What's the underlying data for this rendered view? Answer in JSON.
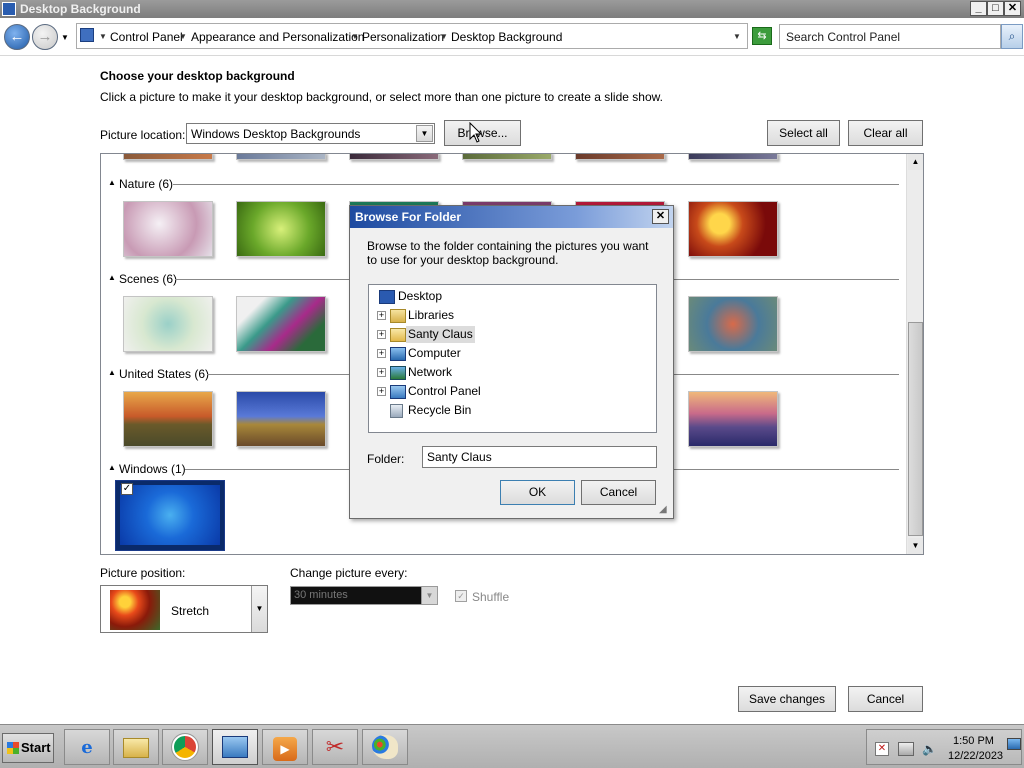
{
  "window": {
    "title": "Desktop Background",
    "min_label": "_",
    "max_label": "□",
    "close_label": "✕"
  },
  "address": {
    "back_glyph": "←",
    "forward_glyph": "→",
    "crumbs": [
      "Control Panel",
      "Appearance and Personalization",
      "Personalization",
      "Desktop Background"
    ],
    "search_placeholder": "Search Control Panel",
    "search_glyph": "⌕",
    "refresh_glyph": "⇆"
  },
  "main": {
    "heading": "Choose your desktop background",
    "description": "Click a picture to make it your desktop background, or select more than one picture to create a slide show.",
    "picture_location_label": "Picture location:",
    "picture_location_value": "Windows Desktop Backgrounds",
    "browse_label": "Browse...",
    "select_all_label": "Select all",
    "clear_all_label": "Clear all",
    "groups": [
      {
        "label": "Nature (6)"
      },
      {
        "label": "Scenes (6)"
      },
      {
        "label": "United States (6)"
      },
      {
        "label": "Windows (1)"
      }
    ],
    "picture_position_label": "Picture position:",
    "picture_position_value": "Stretch",
    "change_every_label": "Change picture every:",
    "change_every_value": "30 minutes",
    "shuffle_label": "Shuffle",
    "save_label": "Save changes",
    "cancel_label": "Cancel"
  },
  "dialog": {
    "title": "Browse For Folder",
    "close_glyph": "✕",
    "instructions": "Browse to the folder containing the pictures you want to use for your desktop background.",
    "tree": [
      {
        "label": "Desktop",
        "expandable": false
      },
      {
        "label": "Libraries",
        "expandable": true
      },
      {
        "label": "Santy Claus",
        "expandable": true,
        "selected": true
      },
      {
        "label": "Computer",
        "expandable": true
      },
      {
        "label": "Network",
        "expandable": true
      },
      {
        "label": "Control Panel",
        "expandable": true
      },
      {
        "label": "Recycle Bin",
        "expandable": false
      }
    ],
    "folder_label": "Folder:",
    "folder_value": "Santy Claus",
    "ok_label": "OK",
    "cancel_label": "Cancel"
  },
  "taskbar": {
    "start_label": "Start",
    "time": "1:50 PM",
    "date": "12/22/2023",
    "icons": [
      "internet-explorer-icon",
      "file-explorer-icon",
      "chrome-icon",
      "control-panel-icon",
      "media-player-icon",
      "snipping-tool-icon",
      "paint-icon"
    ]
  },
  "colors": {
    "accent": "#1d4aa0",
    "selection": "#cce8ff"
  }
}
